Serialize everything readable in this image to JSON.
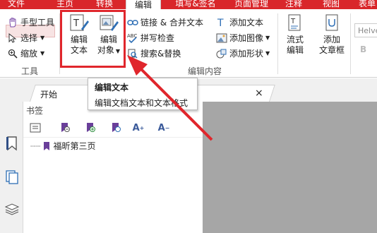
{
  "menubar": {
    "tabs": [
      {
        "label": "文件",
        "active": false
      },
      {
        "label": "主页",
        "active": false
      },
      {
        "label": "转换",
        "active": false
      },
      {
        "label": "编辑",
        "active": true
      },
      {
        "label": "填写&签名",
        "active": false
      },
      {
        "label": "页面管理",
        "active": false
      },
      {
        "label": "注释",
        "active": false
      },
      {
        "label": "视图",
        "active": false
      },
      {
        "label": "表单",
        "active": false
      }
    ]
  },
  "ribbon": {
    "tools_group": {
      "hand": "手型工具",
      "select": "选择",
      "zoom": "缩放",
      "label": "工具"
    },
    "edit_text": {
      "line1": "编辑",
      "line2": "文本"
    },
    "edit_object": {
      "line1": "编辑",
      "line2": "对象"
    },
    "link_merge": "链接 & 合并文本",
    "spell_check": "拼写检查",
    "search_replace": "搜索&替换",
    "add_text": "添加文本",
    "add_image": "添加图像",
    "add_shape": "添加形状",
    "flow_edit": {
      "line1": "流式",
      "line2": "编辑"
    },
    "add_textbox": {
      "line1": "添加",
      "line2": "文章框"
    },
    "font_name": "Helve",
    "bold_label": "B",
    "group_label": "编辑内容"
  },
  "doc_tab": {
    "label": "开始",
    "close": "×"
  },
  "bookmark_panel": {
    "title": "书签",
    "item": "福昕第三页"
  },
  "tooltip": {
    "title": "编辑文本",
    "body": "编辑文档文本和文本格式"
  },
  "colors": {
    "accent": "#d9262a",
    "highlight": "#e0262c",
    "bookmark_purple": "#6a3f9a",
    "doc_gray": "#a6a6a6"
  }
}
